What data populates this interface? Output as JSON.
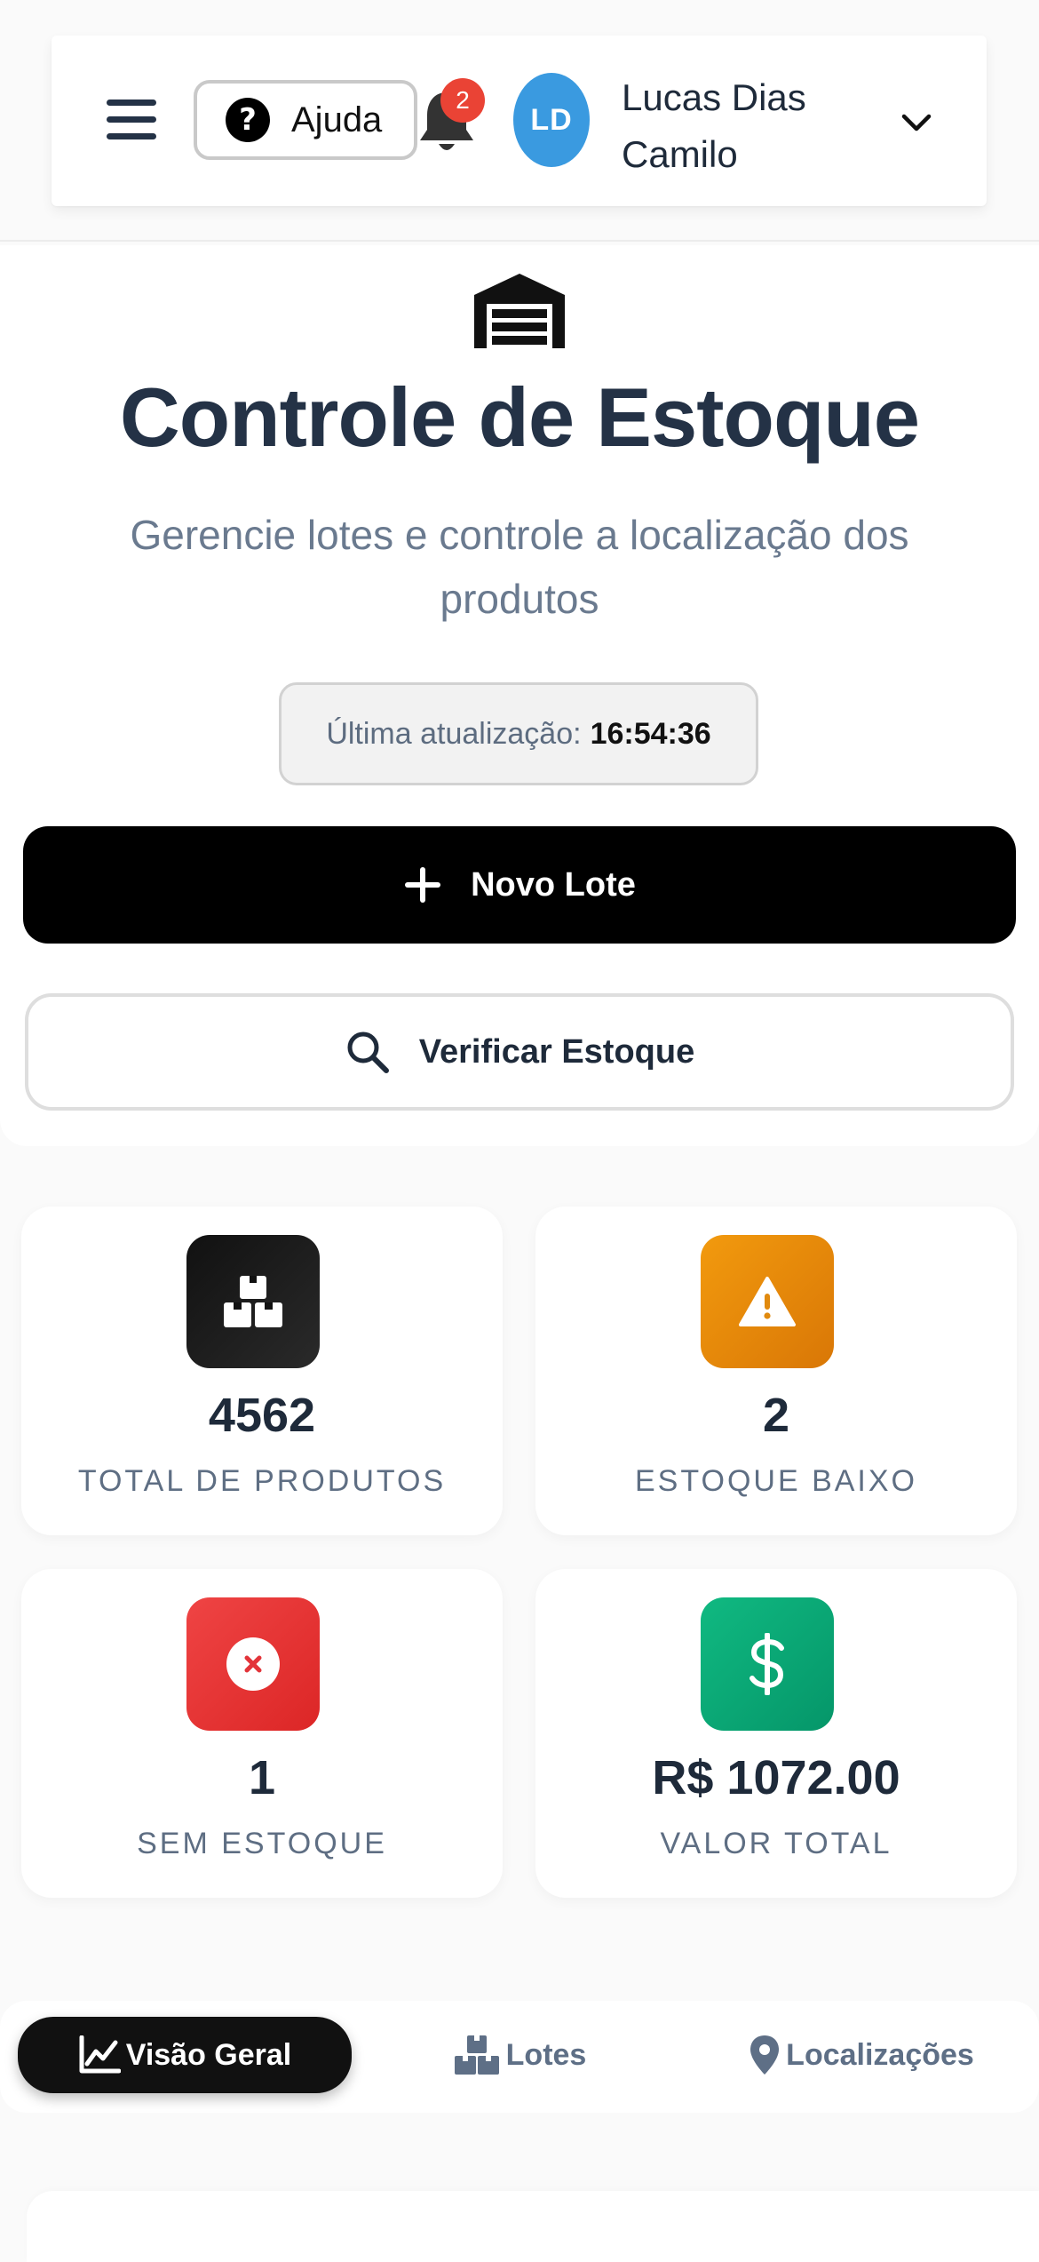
{
  "header": {
    "help_label": "Ajuda",
    "notification_count": "2",
    "user_initials": "LD",
    "user_name": "Lucas Dias Camilo",
    "avatar_color": "#3a9ae0",
    "badge_color": "#ea4335"
  },
  "page": {
    "title": "Controle de Estoque",
    "subtitle": "Gerencie lotes e controle a localização dos produtos",
    "last_update_label": "Última atualização:",
    "last_update_time": "16:54:36"
  },
  "actions": {
    "new_batch": "Novo Lote",
    "check_stock": "Verificar Estoque"
  },
  "stats": [
    {
      "value": "4562",
      "label": "TOTAL DE PRODUTOS",
      "icon": "boxes-icon",
      "color": "#111111"
    },
    {
      "value": "2",
      "label": "ESTOQUE BAIXO",
      "icon": "warning-icon",
      "color": "#e98a0c"
    },
    {
      "value": "1",
      "label": "SEM ESTOQUE",
      "icon": "x-circle-icon",
      "color": "#e3343a"
    },
    {
      "value": "R$ 1072.00",
      "label": "VALOR TOTAL",
      "icon": "dollar-icon",
      "color": "#10a872"
    }
  ],
  "tabs": [
    {
      "label": "Visão Geral",
      "icon": "chart-line-icon",
      "active": true
    },
    {
      "label": "Lotes",
      "icon": "boxes-icon",
      "active": false
    },
    {
      "label": "Localizações",
      "icon": "map-pin-icon",
      "active": false
    }
  ]
}
